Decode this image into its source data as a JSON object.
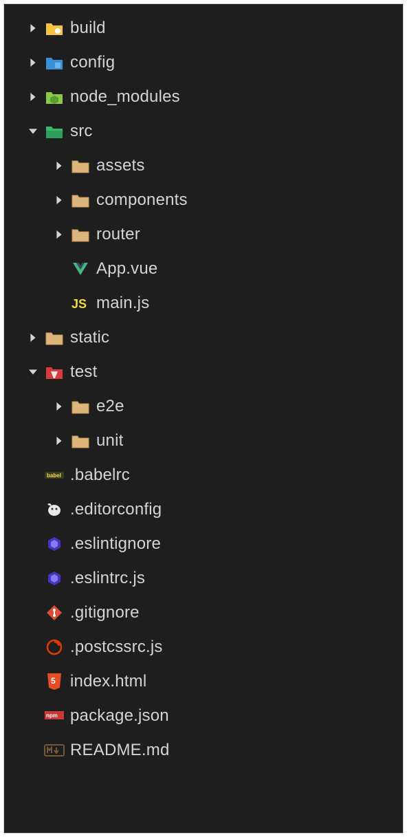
{
  "tree": [
    {
      "label": "build",
      "indent": 0,
      "arrow": "right",
      "icon": "build-folder-icon"
    },
    {
      "label": "config",
      "indent": 0,
      "arrow": "right",
      "icon": "config-folder-icon"
    },
    {
      "label": "node_modules",
      "indent": 0,
      "arrow": "right",
      "icon": "node-folder-icon"
    },
    {
      "label": "src",
      "indent": 0,
      "arrow": "down",
      "icon": "src-folder-icon"
    },
    {
      "label": "assets",
      "indent": 1,
      "arrow": "right",
      "icon": "folder-icon"
    },
    {
      "label": "components",
      "indent": 1,
      "arrow": "right",
      "icon": "folder-icon"
    },
    {
      "label": "router",
      "indent": 1,
      "arrow": "right",
      "icon": "folder-icon"
    },
    {
      "label": "App.vue",
      "indent": 1,
      "arrow": "none",
      "icon": "vue-icon"
    },
    {
      "label": "main.js",
      "indent": 1,
      "arrow": "none",
      "icon": "js-icon"
    },
    {
      "label": "static",
      "indent": 0,
      "arrow": "right",
      "icon": "folder-icon"
    },
    {
      "label": "test",
      "indent": 0,
      "arrow": "down",
      "icon": "test-folder-icon"
    },
    {
      "label": "e2e",
      "indent": 1,
      "arrow": "right",
      "icon": "folder-icon"
    },
    {
      "label": "unit",
      "indent": 1,
      "arrow": "right",
      "icon": "folder-icon"
    },
    {
      "label": ".babelrc",
      "indent": 0,
      "arrow": "none",
      "icon": "babel-icon"
    },
    {
      "label": ".editorconfig",
      "indent": 0,
      "arrow": "none",
      "icon": "editorconfig-icon"
    },
    {
      "label": ".eslintignore",
      "indent": 0,
      "arrow": "none",
      "icon": "eslint-icon"
    },
    {
      "label": ".eslintrc.js",
      "indent": 0,
      "arrow": "none",
      "icon": "eslint-icon"
    },
    {
      "label": ".gitignore",
      "indent": 0,
      "arrow": "none",
      "icon": "git-icon"
    },
    {
      "label": ".postcssrc.js",
      "indent": 0,
      "arrow": "none",
      "icon": "postcss-icon"
    },
    {
      "label": "index.html",
      "indent": 0,
      "arrow": "none",
      "icon": "html-icon"
    },
    {
      "label": "package.json",
      "indent": 0,
      "arrow": "none",
      "icon": "npm-icon"
    },
    {
      "label": "README.md",
      "indent": 0,
      "arrow": "none",
      "icon": "markdown-icon"
    }
  ]
}
